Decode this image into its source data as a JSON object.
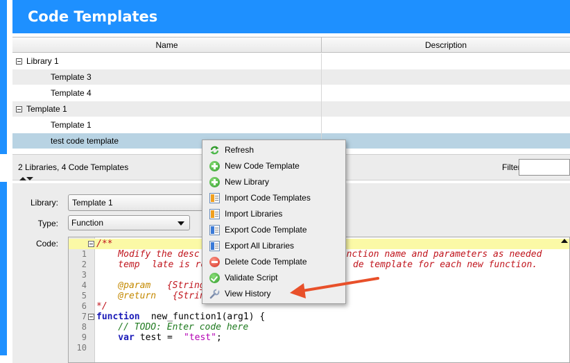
{
  "header": {
    "title": "Code Templates"
  },
  "table": {
    "columns": [
      "Name",
      "Description"
    ],
    "rows": [
      {
        "name": "Library 1",
        "description": "",
        "kind": "library"
      },
      {
        "name": "Template 3",
        "description": "",
        "kind": "template"
      },
      {
        "name": "Template 4",
        "description": "",
        "kind": "template"
      },
      {
        "name": "Template 1",
        "description": "",
        "kind": "library"
      },
      {
        "name": "Template 1",
        "description": "",
        "kind": "template"
      },
      {
        "name": "test code template",
        "description": "",
        "kind": "template",
        "selected": true
      }
    ]
  },
  "status": {
    "count_text": "2 Libraries, 4 Code Templates",
    "filter_label": "Filter:",
    "filter_value": ""
  },
  "form": {
    "library_label": "Library:",
    "library_value": "Template 1",
    "type_label": "Type:",
    "type_value": "Function",
    "code_label": "Code:"
  },
  "code": {
    "line_numbers": [
      "1",
      "2",
      "3",
      "4",
      "5",
      "6",
      "7",
      "8",
      "9",
      "10"
    ],
    "l1": "/**",
    "l2a": "    Modify the desc",
    "l2b": "function name and parameters as needed",
    "l3a": "    temp",
    "l3b": "late is re",
    "l3c": "de template for each new function.",
    "l5a": "    @param",
    "l5b": " {String",
    "l6a": "    @return",
    "l6b": " {String} return description",
    "l7": "*/",
    "l8a": "function",
    "l8b": " new_function1(arg1) {",
    "l9": "    // TODO: Enter code here",
    "l10a": "    var",
    "l10b": " test = ",
    "l10c": "\"test\"",
    "l10d": ";"
  },
  "context_menu": {
    "items": [
      {
        "label": "Refresh",
        "icon": "refresh-icon"
      },
      {
        "label": "New Code Template",
        "icon": "add-icon"
      },
      {
        "label": "New Library",
        "icon": "add-icon"
      },
      {
        "label": "Import Code Templates",
        "icon": "import-icon"
      },
      {
        "label": "Import Libraries",
        "icon": "import-icon"
      },
      {
        "label": "Export Code Template",
        "icon": "export-icon"
      },
      {
        "label": "Export All Libraries",
        "icon": "export-icon"
      },
      {
        "label": "Delete Code Template",
        "icon": "delete-icon"
      },
      {
        "label": "Validate Script",
        "icon": "validate-icon"
      },
      {
        "label": "View History",
        "icon": "wrench-icon"
      }
    ]
  },
  "colors": {
    "header_bg": "#1e90ff",
    "selected_row": "#b8d3e3",
    "highlight_line": "#fbf9a6",
    "annotation_arrow": "#e8502a"
  }
}
